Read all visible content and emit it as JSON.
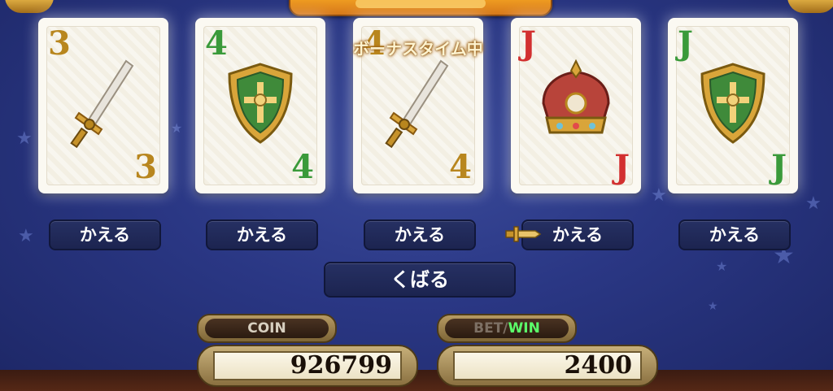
{
  "bonus_label": "ボーナスタイム中",
  "cards": [
    {
      "rank": "3",
      "art": "sword-icon",
      "color": "#b8861e"
    },
    {
      "rank": "4",
      "art": "shield-icon",
      "color": "#3a9a3a"
    },
    {
      "rank": "4",
      "art": "sword-icon",
      "color": "#b8861e"
    },
    {
      "rank": "J",
      "art": "crown-icon",
      "color": "#d23030"
    },
    {
      "rank": "J",
      "art": "shield-icon",
      "color": "#3a9a3a"
    }
  ],
  "exchange_label": "かえる",
  "hold_label": "くばる",
  "coin": {
    "label": "COIN",
    "value": "926799"
  },
  "win": {
    "bet_label": "BET/",
    "win_label": "WIN",
    "value": "2400"
  },
  "colors": {
    "felt": "#2a3784",
    "gold": "#b8861e",
    "green": "#3a9a3a",
    "red": "#d23030",
    "win_green": "#5bff6a"
  }
}
